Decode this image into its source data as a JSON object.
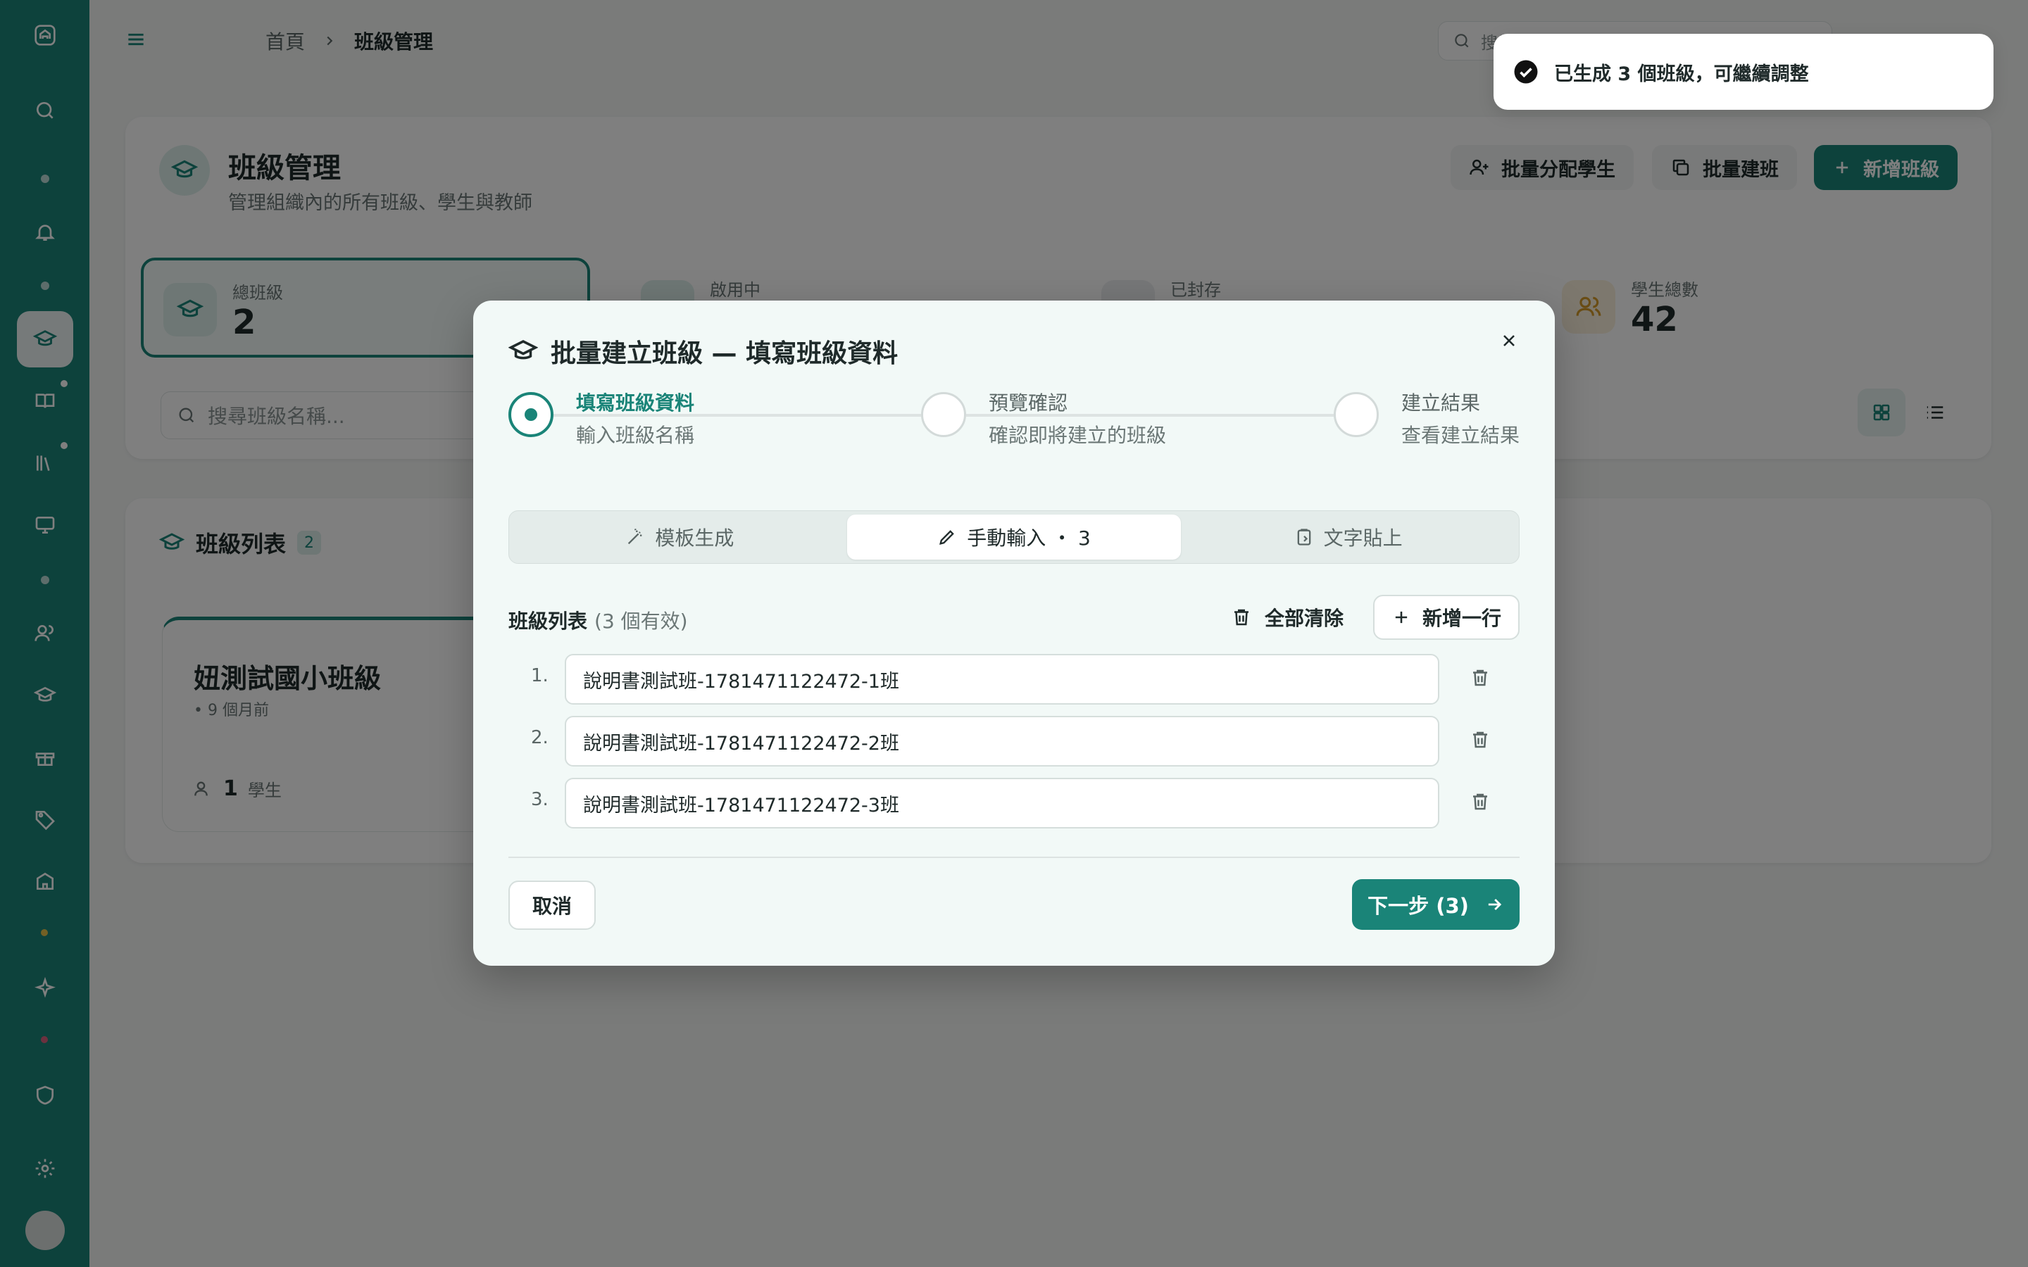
{
  "colors": {
    "brand": "#1a8478",
    "overlay": "rgba(0,0,0,0.5)",
    "modal_bg": "#f2f9f7"
  },
  "breadcrumb": {
    "home": "首頁",
    "current": "班級管理"
  },
  "top_search": {
    "placeholder": "搜尋頁面、功能..."
  },
  "page_header": {
    "title": "班級管理",
    "subtitle": "管理組織內的所有班級、學生與教師",
    "buttons": {
      "assign": "批量分配學生",
      "batch_create": "批量建班",
      "new_class": "新增班級"
    }
  },
  "stats": [
    {
      "label": "總班級",
      "value": "2"
    },
    {
      "label": "啟用中",
      "value": ""
    },
    {
      "label": "已封存",
      "value": ""
    },
    {
      "label": "學生總數",
      "value": "42"
    }
  ],
  "filter": {
    "search_placeholder": "搜尋班級名稱..."
  },
  "class_list": {
    "title": "班級列表",
    "count": "2",
    "first_card": {
      "title": "妞測試國小班級",
      "time": "• 9 個月前",
      "students": "1",
      "students_label": "學生"
    }
  },
  "modal": {
    "title": "批量建立班級 — 填寫班級資料",
    "steps": [
      {
        "name": "填寫班級資料",
        "desc": "輸入班級名稱"
      },
      {
        "name": "預覽確認",
        "desc": "確認即將建立的班級"
      },
      {
        "name": "建立結果",
        "desc": "查看建立結果"
      }
    ],
    "tabs": [
      {
        "label": "模板生成"
      },
      {
        "label": "手動輸入 ・ 3"
      },
      {
        "label": "文字貼上"
      }
    ],
    "list_label": "班級列表",
    "valid_count": "(3 個有效)",
    "clear_all": "全部清除",
    "add_row": "新增一行",
    "rows": [
      {
        "num": "1.",
        "value": "說明書測試班-1781471122472-1班"
      },
      {
        "num": "2.",
        "value": "說明書測試班-1781471122472-2班"
      },
      {
        "num": "3.",
        "value": "說明書測試班-1781471122472-3班"
      }
    ],
    "cancel": "取消",
    "next": "下一步 (3)"
  },
  "toast": {
    "message": "已生成 3 個班級，可繼續調整"
  }
}
